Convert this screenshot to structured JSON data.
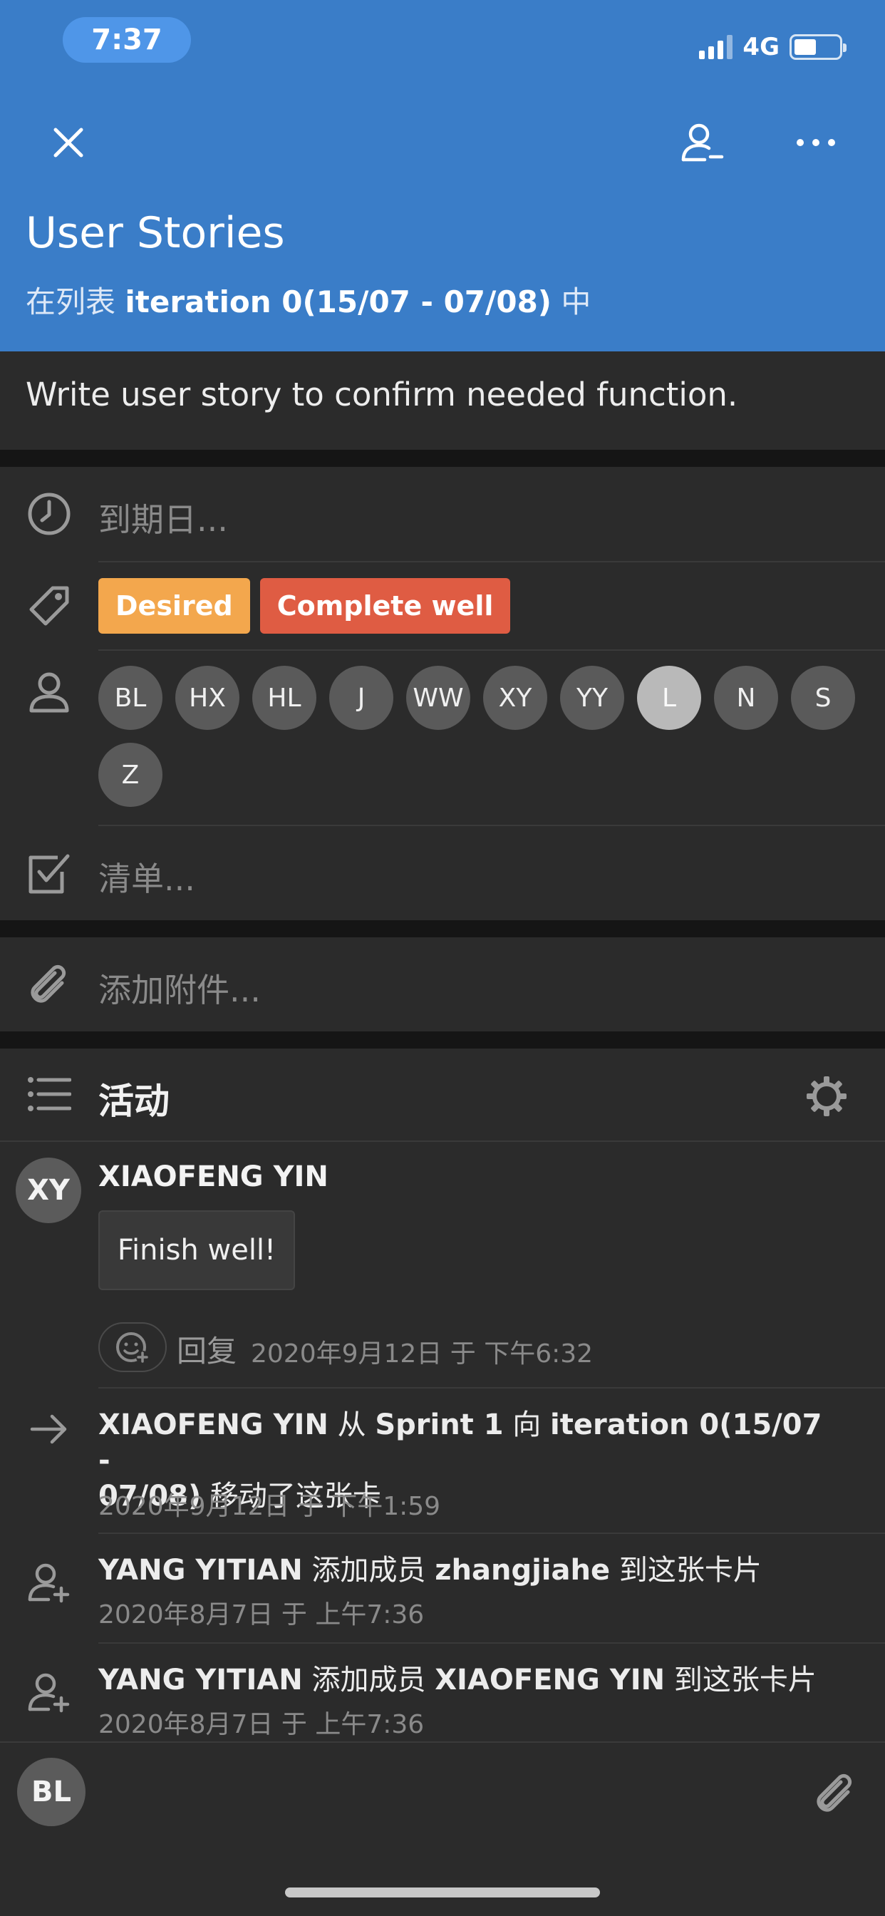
{
  "status_bar": {
    "time": "7:37",
    "network": "4G"
  },
  "header": {
    "title": "User Stories",
    "list_prefix": "在列表",
    "list_name": "iteration 0(15/07 - 07/08)",
    "list_suffix": "中"
  },
  "description": "Write user story to confirm needed function.",
  "due_date": {
    "placeholder": "到期日..."
  },
  "labels": [
    {
      "text": "Desired",
      "color": "#f3a74d"
    },
    {
      "text": "Complete well",
      "color": "#df5c43"
    }
  ],
  "members": [
    "BL",
    "HX",
    "HL",
    "J",
    "WW",
    "XY",
    "YY",
    "L",
    "N",
    "S",
    "Z"
  ],
  "checklist": {
    "placeholder": "清单..."
  },
  "attachment": {
    "placeholder": "添加附件..."
  },
  "activity": {
    "title": "活动",
    "comment": {
      "avatar": "XY",
      "author": "XIAOFENG YIN",
      "text": "Finish well!",
      "reply_label": "回复",
      "date": "2020年9月12日 于 下午6:32"
    },
    "log": [
      {
        "icon": "arrow-right-icon",
        "actor": "XIAOFENG YIN",
        "p1": "从",
        "from": "Sprint 1",
        "p2": "向",
        "to_a": "iteration 0(15/07 -",
        "to_b": "07/08)",
        "p3": "移动了这张卡",
        "date": "2020年9月12日 于 下午1:59"
      },
      {
        "icon": "add-member-icon",
        "actor": "YANG YITIAN",
        "p1": "添加成员",
        "member": "zhangjiahe",
        "p2": "到这张卡片",
        "date": "2020年8月7日 于 上午7:36"
      },
      {
        "icon": "add-member-icon",
        "actor": "YANG YITIAN",
        "p1": "添加成员",
        "member": "XIAOFENG YIN",
        "p2": "到这张卡片",
        "date": "2020年8月7日 于 上午7:36"
      }
    ]
  },
  "composer": {
    "avatar": "BL"
  },
  "colors": {
    "header_bg": "#3a7dc8",
    "body_bg": "#2b2b2b"
  }
}
